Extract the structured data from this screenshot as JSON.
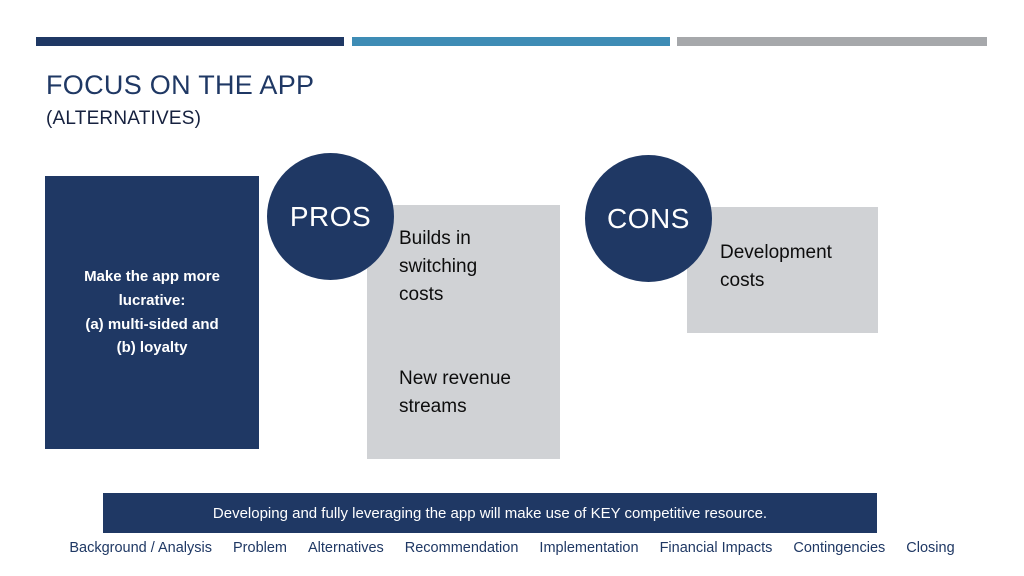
{
  "slide": {
    "title": "FOCUS ON THE APP",
    "subtitle": "(ALTERNATIVES)",
    "colors": {
      "navy": "#1F3864",
      "blue": "#3E8CB5",
      "gray_rule": "#A6A8AB",
      "panel_gray": "#D0D2D5",
      "white": "#FFFFFF"
    }
  },
  "top_rule": {
    "segments": [
      {
        "name": "navy-segment",
        "color": "#1F3864"
      },
      {
        "name": "blue-segment",
        "color": "#3E8CB5"
      },
      {
        "name": "gray-segment",
        "color": "#A6A8AB"
      }
    ]
  },
  "alternative": {
    "text": "Make the app more lucrative:\n(a) multi-sided and\n(b) loyalty"
  },
  "pros": {
    "label": "PROS",
    "items": [
      "Builds in\nswitching\ncosts",
      "New revenue\nstreams"
    ]
  },
  "cons": {
    "label": "CONS",
    "items": [
      "Development\ncosts"
    ]
  },
  "banner": {
    "text": "Developing and fully leveraging the app will make use of KEY competitive resource."
  },
  "nav": {
    "items": [
      {
        "label": "Background / Analysis"
      },
      {
        "label": "Problem"
      },
      {
        "label": "Alternatives"
      },
      {
        "label": "Recommendation"
      },
      {
        "label": "Implementation"
      },
      {
        "label": "Financial Impacts"
      },
      {
        "label": "Contingencies"
      },
      {
        "label": "Closing"
      }
    ]
  }
}
